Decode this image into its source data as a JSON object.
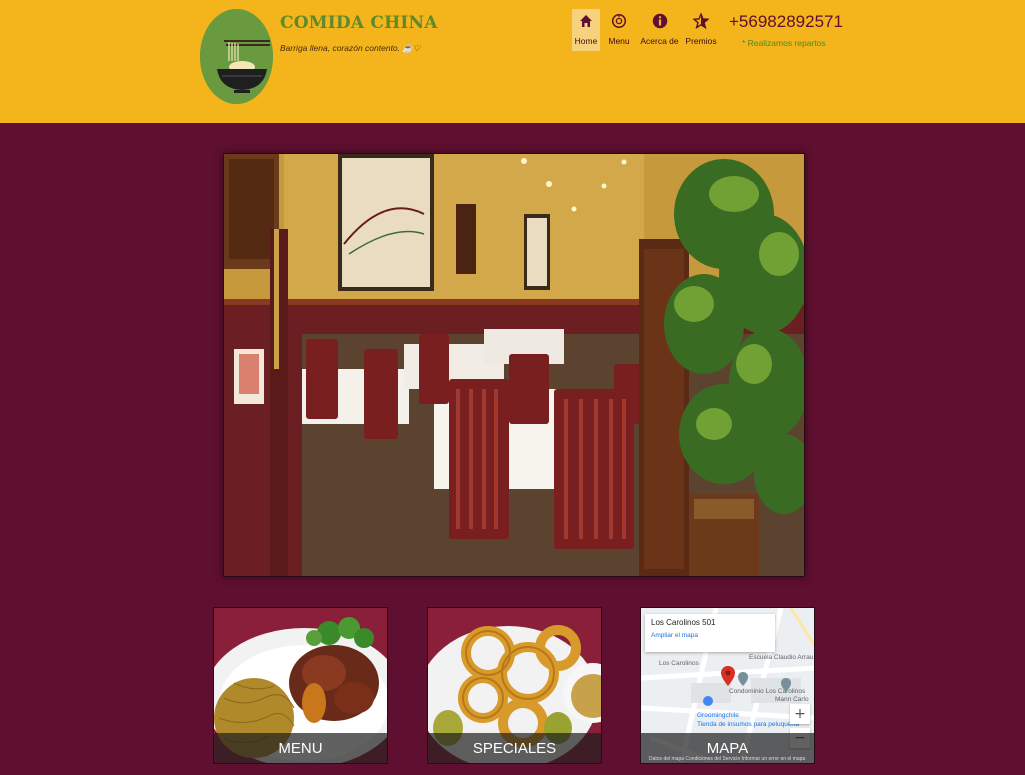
{
  "header": {
    "brand_title": "COMIDA CHINA",
    "tagline": "Barriga llena, corazón contento. ☕♡",
    "phone": "+56982892571",
    "delivery_note": "* Realizamos repartos",
    "colors": {
      "header_bg": "#f3b51b",
      "page_bg": "#5f0f2f",
      "brand_green": "#5f8a2b"
    }
  },
  "nav": {
    "items": [
      {
        "label": "Home",
        "icon": "home-icon",
        "active": true
      },
      {
        "label": "Menu",
        "icon": "menu-icon",
        "active": false
      },
      {
        "label": "Acerca de",
        "icon": "info-icon",
        "active": false
      },
      {
        "label": "Premios",
        "icon": "star-icon",
        "active": false
      }
    ]
  },
  "cards": [
    {
      "label": "MENU"
    },
    {
      "label": "SPECIALES"
    },
    {
      "label": "MAPA"
    }
  ],
  "map": {
    "address": "Los Carolinos 501",
    "link": "Ampliar el mapa",
    "labels": [
      "Escuela Claudio Arrau",
      "Condominio Los Carolinos",
      "Groomingchile",
      "Tienda de insumos para peluquería",
      "Los Carolinos",
      "Mann Carlo"
    ],
    "footer": "Datos del mapa  Condiciones del Servicio  Informar un error en el mapa",
    "zoom_in": "+",
    "zoom_out": "−"
  }
}
